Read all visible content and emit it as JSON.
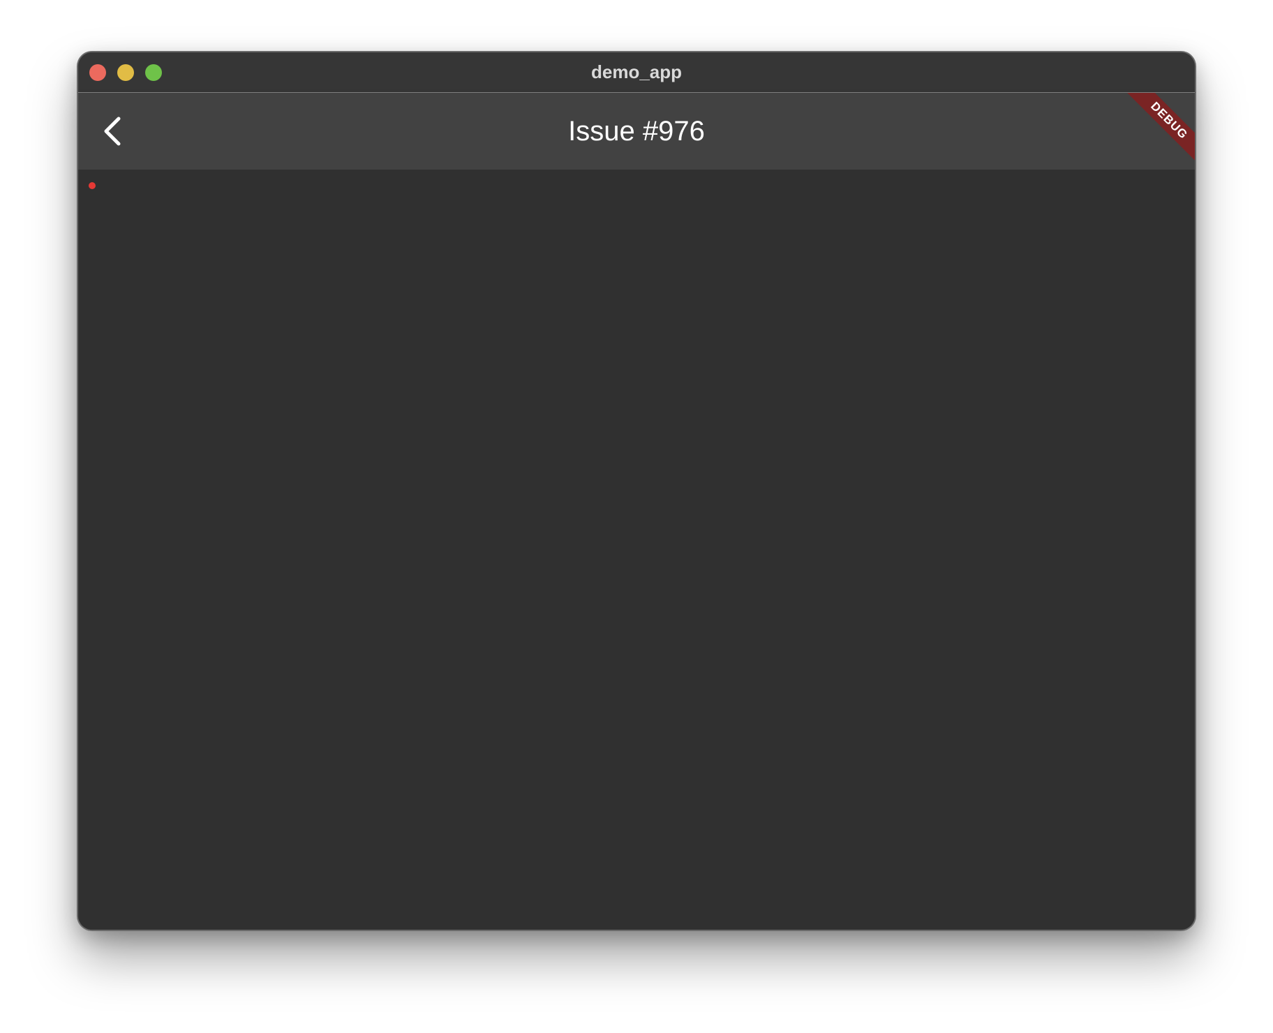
{
  "window": {
    "title": "demo_app",
    "traffic_lights": {
      "close_color": "#ec6a5e",
      "minimize_color": "#e1bc45",
      "zoom_color": "#6fc249"
    }
  },
  "appbar": {
    "back_icon": "chevron-left-icon",
    "title": "Issue #976",
    "background": "#424242"
  },
  "debug_banner": {
    "label": "DEBUG",
    "color": "#7a2424"
  },
  "content": {
    "background": "#303030",
    "indicator_color": "#e53935"
  }
}
